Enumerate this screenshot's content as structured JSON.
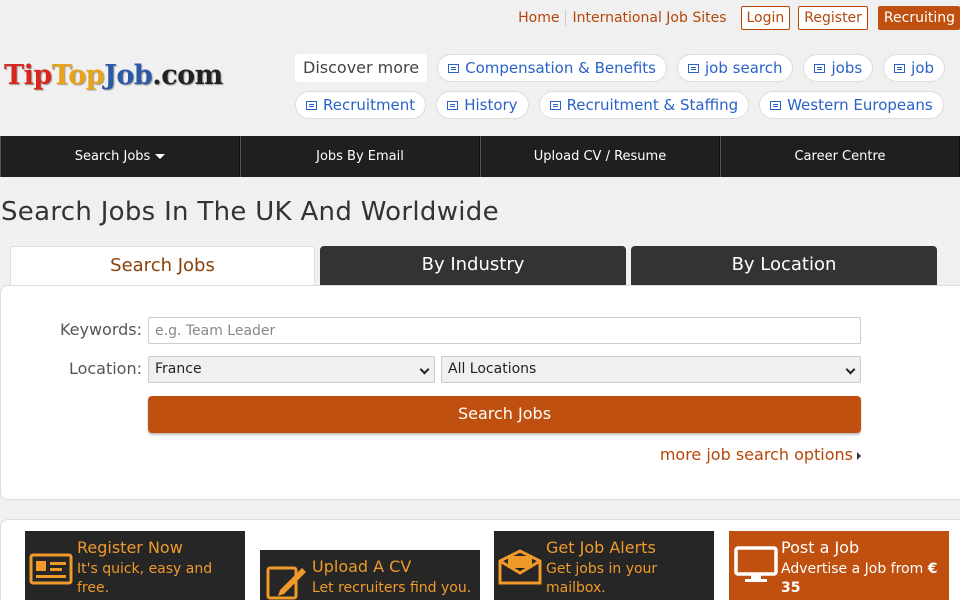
{
  "toplinks": {
    "home": "Home",
    "international": "International Job Sites",
    "login": "Login",
    "register": "Register",
    "recruiting": "Recruiting"
  },
  "logo": {
    "part1": "Tip",
    "part2": "Top",
    "part3": "Job",
    "part4": ".com"
  },
  "discover": "Discover more",
  "tags_row1": [
    "Compensation & Benefits",
    "job search",
    "jobs",
    "job"
  ],
  "tags_row2": [
    "Recruitment",
    "History",
    "Recruitment & Staffing",
    "Western Europeans"
  ],
  "nav": [
    "Search Jobs",
    "Jobs By Email",
    "Upload CV / Resume",
    "Career Centre"
  ],
  "page_title": "Search Jobs In The UK And Worldwide",
  "tabs": [
    "Search Jobs",
    "By Industry",
    "By Location"
  ],
  "form": {
    "keywords_label": "Keywords:",
    "keywords_placeholder": "e.g. Team Leader",
    "location_label": "Location:",
    "country": "France",
    "region": "All Locations",
    "search_button": "Search Jobs",
    "more_options": "more job search options"
  },
  "cards": [
    {
      "title": "Register Now",
      "text1": "It's quick, easy and",
      "text2": "free.",
      "icon": "id-card-icon"
    },
    {
      "title": "Upload A CV",
      "text1": "Let recruiters find you.",
      "text2": "",
      "icon": "edit-document-icon"
    },
    {
      "title": "Get Job Alerts",
      "text1": "Get jobs in your",
      "text2": "mailbox.",
      "icon": "envelope-icon"
    },
    {
      "title": "Post a Job",
      "text1": "Advertise a Job from",
      "text1b": "€",
      "text2": "35",
      "icon": "monitor-icon"
    }
  ],
  "colors": {
    "accent": "#c0500f",
    "link": "#2a62c9",
    "nav": "#1f1f1f"
  }
}
